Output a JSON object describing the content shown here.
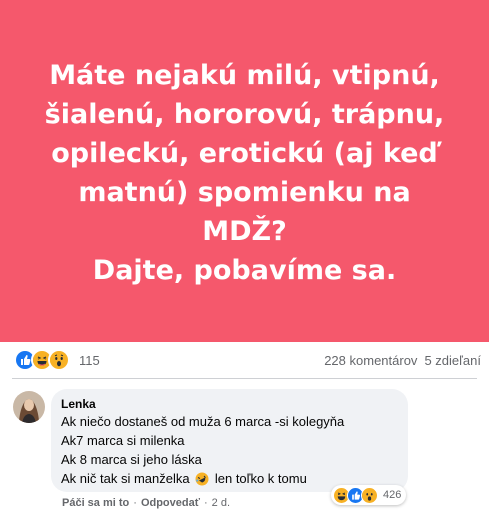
{
  "post": {
    "background_color": "#f5586c",
    "headline": "Máte nejakú milú, vtipnú,\nšialenú, hororovú, trápnu,\nopileckú, erotickú (aj keď\nmatnú) spomienku na MDŽ?\nDajte, pobavíme sa.",
    "reactions": {
      "icons": [
        "like-icon",
        "haha-icon",
        "wow-icon"
      ],
      "count": "115"
    },
    "comments_count": "228 komentárov",
    "shares_count": "5 zdieľaní"
  },
  "comment": {
    "author": "Lenka",
    "lines": [
      "Ak niečo dostaneš od muža 6 marca -si kolegyňa",
      "Ak7 marca si milenka",
      "Ak 8 marca si jeho láska"
    ],
    "last_line_start": "Ak nič tak si manželka",
    "last_line_emoji": "rolling-laughing-emoji-icon",
    "last_line_end": "len toľko k tomu",
    "reactions": {
      "icons": [
        "haha-icon",
        "like-icon",
        "wow-icon"
      ],
      "count": "426"
    },
    "actions": {
      "like": "Páči sa mi to",
      "separator": "·",
      "reply": "Odpovedať",
      "separator2": "·",
      "time": "2 d."
    }
  }
}
